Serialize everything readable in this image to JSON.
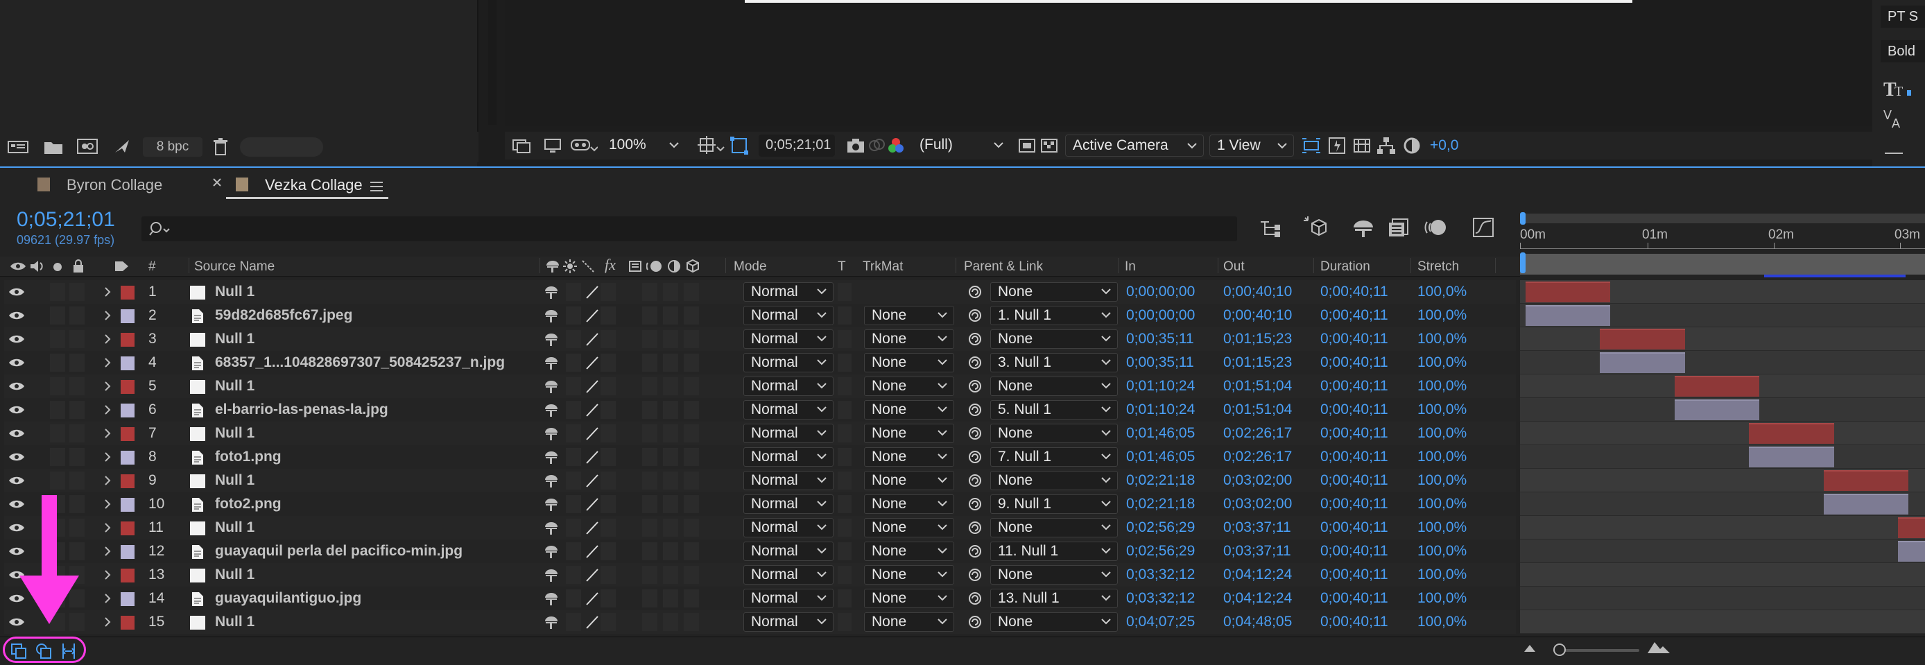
{
  "top": {
    "bpc_label": "8 bpc",
    "zoom": "100%",
    "timecode": "0;05;21;01",
    "resolution": "(Full)",
    "camera": "Active Camera",
    "view_layout": "1 View",
    "exposure": "+0,0",
    "font_name": "PT S",
    "font_style": "Bold"
  },
  "tabs": [
    {
      "label": "Byron Collage"
    },
    {
      "label": "Vezka Collage"
    }
  ],
  "timeline": {
    "current_time": "0;05;21;01",
    "frame_info": "09621 (29.97 fps)",
    "search_placeholder": "",
    "ruler": [
      "00m",
      "01m",
      "02m",
      "03m"
    ]
  },
  "columns": {
    "num": "#",
    "source_name": "Source Name",
    "mode": "Mode",
    "t": "T",
    "trkmat": "TrkMat",
    "parent": "Parent & Link",
    "in": "In",
    "out": "Out",
    "duration": "Duration",
    "stretch": "Stretch"
  },
  "colors": {
    "red_label": "#b03a3a",
    "lavender_label": "#b7b4d6",
    "accent_blue": "#4a9ff5",
    "red_bar": "#8e3838",
    "lavender_bar": "#7d7b93",
    "annotation": "#ff3be6"
  },
  "layers": [
    {
      "num": "1",
      "name": "Null 1",
      "type": "null",
      "mode": "Normal",
      "trkmat": "",
      "parent": "None",
      "in": "0;00;00;00",
      "out": "0;00;40;10",
      "duration": "0;00;40;11",
      "stretch": "100,0%"
    },
    {
      "num": "2",
      "name": "59d82d685fc67.jpeg",
      "type": "file",
      "mode": "Normal",
      "trkmat": "None",
      "parent": "1. Null 1",
      "in": "0;00;00;00",
      "out": "0;00;40;10",
      "duration": "0;00;40;11",
      "stretch": "100,0%"
    },
    {
      "num": "3",
      "name": "Null 1",
      "type": "null",
      "mode": "Normal",
      "trkmat": "None",
      "parent": "None",
      "in": "0;00;35;11",
      "out": "0;01;15;23",
      "duration": "0;00;40;11",
      "stretch": "100,0%"
    },
    {
      "num": "4",
      "name": "68357_1...104828697307_508425237_n.jpg",
      "type": "file",
      "mode": "Normal",
      "trkmat": "None",
      "parent": "3. Null 1",
      "in": "0;00;35;11",
      "out": "0;01;15;23",
      "duration": "0;00;40;11",
      "stretch": "100,0%"
    },
    {
      "num": "5",
      "name": "Null 1",
      "type": "null",
      "mode": "Normal",
      "trkmat": "None",
      "parent": "None",
      "in": "0;01;10;24",
      "out": "0;01;51;04",
      "duration": "0;00;40;11",
      "stretch": "100,0%"
    },
    {
      "num": "6",
      "name": "el-barrio-las-penas-la.jpg",
      "type": "file",
      "mode": "Normal",
      "trkmat": "None",
      "parent": "5. Null 1",
      "in": "0;01;10;24",
      "out": "0;01;51;04",
      "duration": "0;00;40;11",
      "stretch": "100,0%"
    },
    {
      "num": "7",
      "name": "Null 1",
      "type": "null",
      "mode": "Normal",
      "trkmat": "None",
      "parent": "None",
      "in": "0;01;46;05",
      "out": "0;02;26;17",
      "duration": "0;00;40;11",
      "stretch": "100,0%"
    },
    {
      "num": "8",
      "name": "foto1.png",
      "type": "file",
      "mode": "Normal",
      "trkmat": "None",
      "parent": "7. Null 1",
      "in": "0;01;46;05",
      "out": "0;02;26;17",
      "duration": "0;00;40;11",
      "stretch": "100,0%"
    },
    {
      "num": "9",
      "name": "Null 1",
      "type": "null",
      "mode": "Normal",
      "trkmat": "None",
      "parent": "None",
      "in": "0;02;21;18",
      "out": "0;03;02;00",
      "duration": "0;00;40;11",
      "stretch": "100,0%"
    },
    {
      "num": "10",
      "name": "foto2.png",
      "type": "file",
      "mode": "Normal",
      "trkmat": "None",
      "parent": "9. Null 1",
      "in": "0;02;21;18",
      "out": "0;03;02;00",
      "duration": "0;00;40;11",
      "stretch": "100,0%"
    },
    {
      "num": "11",
      "name": "Null 1",
      "type": "null",
      "mode": "Normal",
      "trkmat": "None",
      "parent": "None",
      "in": "0;02;56;29",
      "out": "0;03;37;11",
      "duration": "0;00;40;11",
      "stretch": "100,0%"
    },
    {
      "num": "12",
      "name": "guayaquil perla del pacifico-min.jpg",
      "type": "file",
      "mode": "Normal",
      "trkmat": "None",
      "parent": "11. Null 1",
      "in": "0;02;56;29",
      "out": "0;03;37;11",
      "duration": "0;00;40;11",
      "stretch": "100,0%"
    },
    {
      "num": "13",
      "name": "Null 1",
      "type": "null",
      "mode": "Normal",
      "trkmat": "None",
      "parent": "None",
      "in": "0;03;32;12",
      "out": "0;04;12;24",
      "duration": "0;00;40;11",
      "stretch": "100,0%"
    },
    {
      "num": "14",
      "name": "guayaquilantiguo.jpg",
      "type": "file",
      "mode": "Normal",
      "trkmat": "None",
      "parent": "13. Null 1",
      "in": "0;03;32;12",
      "out": "0;04;12;24",
      "duration": "0;00;40;11",
      "stretch": "100,0%"
    },
    {
      "num": "15",
      "name": "Null 1",
      "type": "null",
      "mode": "Normal",
      "trkmat": "None",
      "parent": "None",
      "in": "0;04;07;25",
      "out": "0;04;48;05",
      "duration": "0;00;40;11",
      "stretch": "100,0%"
    }
  ]
}
